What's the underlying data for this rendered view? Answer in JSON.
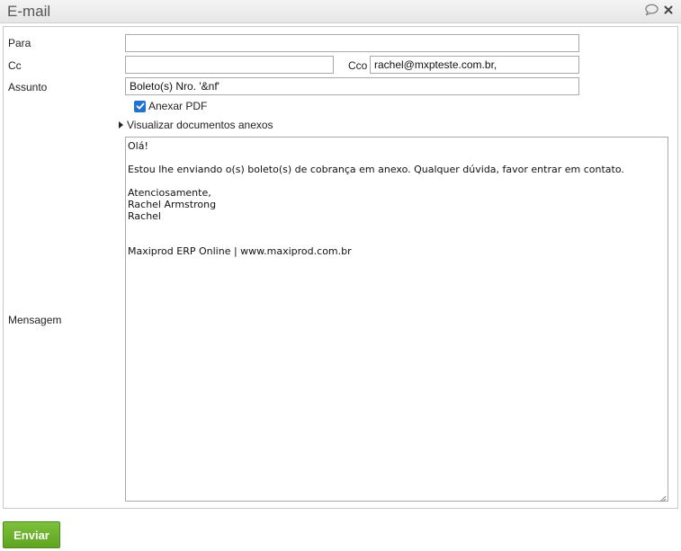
{
  "window": {
    "title": "E-mail",
    "icons": [
      "chat-bubble-icon",
      "close-icon"
    ]
  },
  "form": {
    "para": {
      "label": "Para",
      "value": ""
    },
    "cc": {
      "label": "Cc",
      "value": ""
    },
    "cco": {
      "label": "Cco",
      "value": "rachel@mxpteste.com.br,"
    },
    "assunto": {
      "label": "Assunto",
      "value": "Boleto(s) Nro. '&nf'"
    },
    "attach_pdf": {
      "label": "Anexar PDF",
      "checked": true
    },
    "view_attachments": {
      "label": "Visualizar documentos anexos"
    },
    "mensagem": {
      "label": "Mensagem",
      "value": "Olá!\n\nEstou lhe enviando o(s) boleto(s) de cobrança em anexo. Qualquer dúvida, favor entrar em contato.\n\nAtenciosamente,\nRachel Armstrong\nRachel\n\n\nMaxiprod ERP Online | www.maxiprod.com.br"
    }
  },
  "actions": {
    "send_label": "Enviar"
  },
  "colors": {
    "send_button": "#6ab22a",
    "checkbox": "#1f73d6"
  }
}
